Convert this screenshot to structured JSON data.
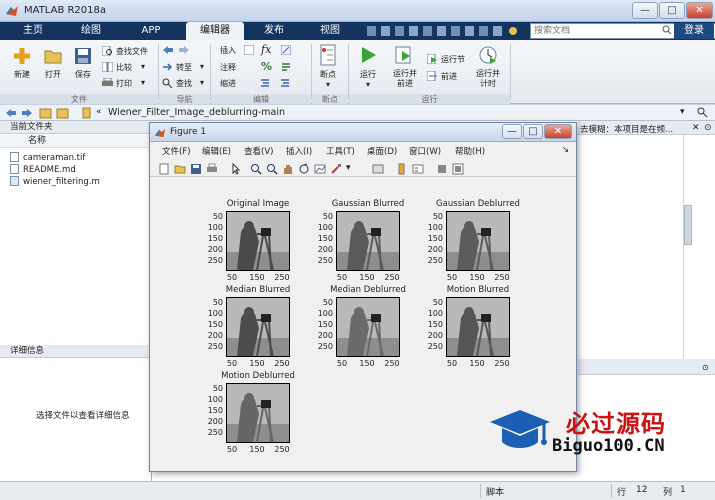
{
  "window": {
    "title": "MATLAB R2018a",
    "btn_min": "—",
    "btn_max": "□",
    "btn_close": "✕"
  },
  "tabs": [
    "主页",
    "绘图",
    "APP",
    "编辑器",
    "发布",
    "视图"
  ],
  "search_placeholder": "搜索文档",
  "login": "登录",
  "toolstrip": {
    "file": {
      "new": "新建",
      "open": "打开",
      "save": "保存",
      "find_files": "查找文件",
      "compare": "比较",
      "print": "打印",
      "label": "文件"
    },
    "nav": {
      "goto": "转至",
      "find": "查找",
      "label": "导航"
    },
    "edit": {
      "insert": "插入",
      "comment": "注释",
      "indent": "缩进",
      "fx": "fx",
      "pct": "%",
      "label": "编辑"
    },
    "breakpoints": {
      "bp": "断点",
      "label": "断点"
    },
    "run": {
      "run": "运行",
      "run_advance": "运行并\n前进",
      "run_section": "运行节",
      "advance": "前进",
      "run_time": "运行并\n计时",
      "label": "运行"
    }
  },
  "address": {
    "path": "Wiener_Filter_Image_deblurring-main"
  },
  "current_folder": {
    "title": "当前文件夹",
    "col_name": "名称",
    "files": [
      "cameraman.tif",
      "README.md",
      "wiener_filtering.m"
    ]
  },
  "details": {
    "title": "详细信息",
    "message": "选择文件以查看详细信息"
  },
  "right_notice": "去模糊：本项目是在频...",
  "figure": {
    "title": "Figure 1",
    "menu": [
      "文件(F)",
      "编辑(E)",
      "查看(V)",
      "插入(I)",
      "工具(T)",
      "桌面(D)",
      "窗口(W)",
      "帮助(H)"
    ],
    "subplots": [
      {
        "title": "Original Image"
      },
      {
        "title": "Gaussian Blurred"
      },
      {
        "title": "Gaussian Deblurred"
      },
      {
        "title": "Median Blurred"
      },
      {
        "title": "Median Deblurred"
      },
      {
        "title": "Motion Blurred"
      },
      {
        "title": "Motion Deblurred"
      }
    ],
    "yticks": [
      "50",
      "100",
      "150",
      "200",
      "250"
    ],
    "xticks": [
      "50",
      "150",
      "250"
    ]
  },
  "status": {
    "script": "脚本",
    "row_label": "行",
    "row": "12",
    "col_label": "列",
    "col": "1"
  },
  "watermark": {
    "brand": "必过源码",
    "url": "Biguo100.CN"
  },
  "colors": {
    "tab_bg": "#12345f",
    "accent_blue": "#1a5fb4",
    "watermark_red": "#cc1111"
  }
}
